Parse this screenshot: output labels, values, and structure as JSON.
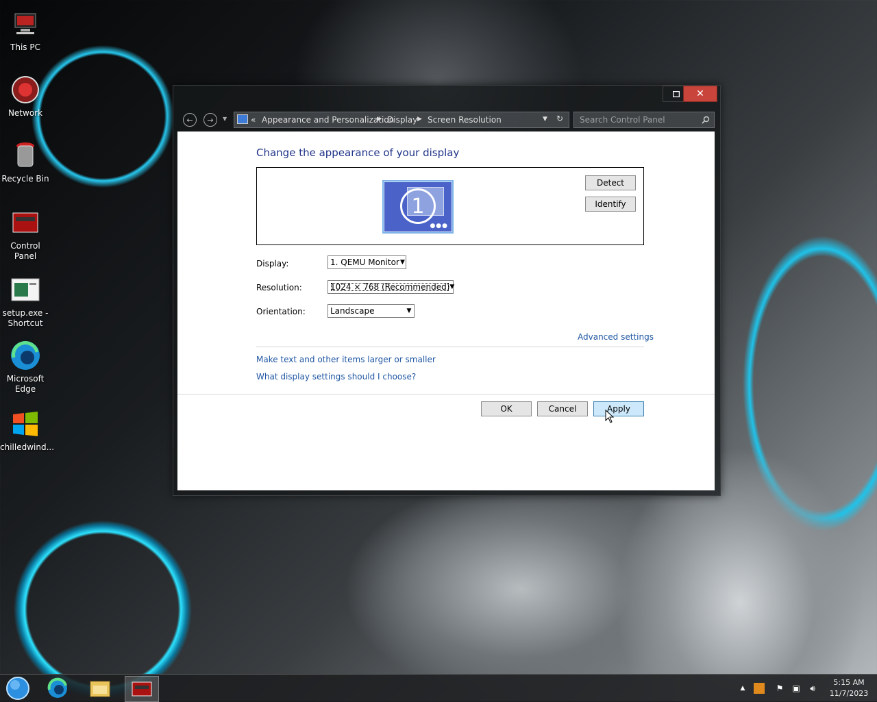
{
  "desktop": {
    "icons": [
      {
        "label": "This PC"
      },
      {
        "label": "Network"
      },
      {
        "label": "Recycle Bin"
      },
      {
        "label": "Control Panel"
      },
      {
        "label": "setup.exe - Shortcut"
      },
      {
        "label": "Microsoft Edge"
      },
      {
        "label": "chilledwind..."
      }
    ]
  },
  "window": {
    "address": {
      "prefix": "«",
      "crumbs": [
        "Appearance and Personalization",
        "Display",
        "Screen Resolution"
      ]
    },
    "search_placeholder": "Search Control Panel",
    "close_glyph": "✕"
  },
  "dialog": {
    "heading": "Change the appearance of your display",
    "monitor_number": "1",
    "detect_label": "Detect",
    "identify_label": "Identify",
    "display_label": "Display:",
    "display_value": "1. QEMU Monitor",
    "resolution_label": "Resolution:",
    "resolution_value": "1024 × 768 (Recommended)",
    "orientation_label": "Orientation:",
    "orientation_value": "Landscape",
    "advanced_link": "Advanced settings",
    "link_text_size": "Make text and other items larger or smaller",
    "link_help": "What display settings should I choose?",
    "ok_label": "OK",
    "cancel_label": "Cancel",
    "apply_label": "Apply"
  },
  "taskbar": {
    "time": "5:15 AM",
    "date": "11/7/2023"
  },
  "colors": {
    "heading": "#1e3287",
    "link": "#1e56a3",
    "close_button": "#c9453b",
    "apply_highlight": "#cde8fb"
  }
}
